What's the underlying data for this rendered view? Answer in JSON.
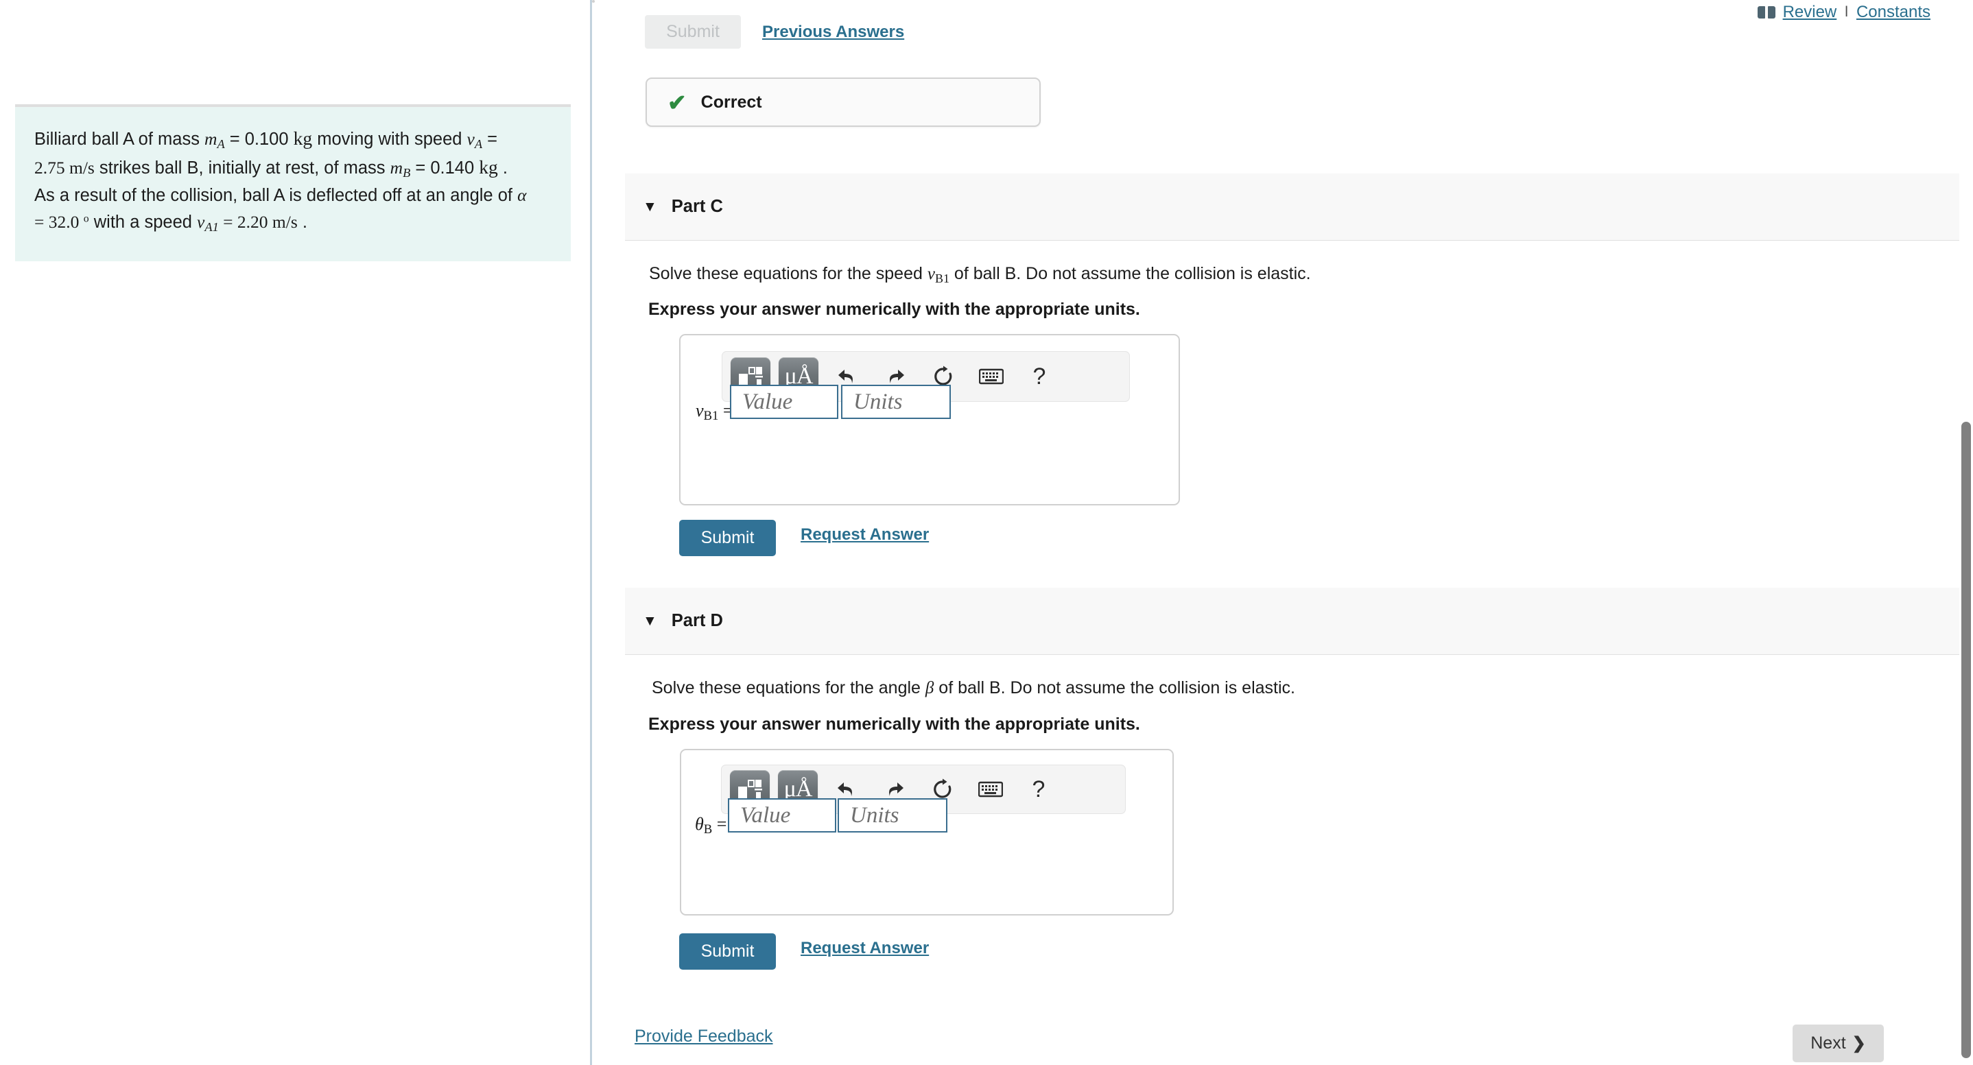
{
  "top_links": {
    "book_icon": "book-icon",
    "review": "Review",
    "separator": "l",
    "constants": "Constants"
  },
  "previous_section": {
    "submit_disabled_label": "Submit",
    "previous_answers_label": "Previous Answers",
    "feedback_icon": "check-icon",
    "feedback_label": "Correct"
  },
  "problem": {
    "line1_a": "Billiard ball A of mass ",
    "m_A": "m",
    "m_A_sub": "A",
    "eq1": " = 0.100 ",
    "kg1": "kg",
    "line1_b": " moving with speed ",
    "v_A": "v",
    "v_A_sub": "A",
    "eq2": " =",
    "line2_a": "2.75 ",
    "ms1": "m/s",
    "line2_b": " strikes ball B, initially at rest, of mass ",
    "m_B": "m",
    "m_B_sub": "B",
    "eq3": " = 0.140 ",
    "kg2": "kg",
    "line2_c": " .",
    "line3": "As a result of the collision, ball A is deflected off at an angle of ",
    "alpha": "α",
    "line4_a": "= 32.0 ",
    "degree": "o",
    "line4_b": " with a speed ",
    "v_A1": "v",
    "v_A1_sub": "A1",
    "eq4": " = 2.20 ",
    "ms2": "m/s",
    "line4_c": " ."
  },
  "parts": [
    {
      "caret": "▼",
      "title": "Part C",
      "prompt_pre": "Solve these equations for the speed ",
      "prompt_var": "v",
      "prompt_var_sub": "B1",
      "prompt_post": " of ball B. Do not assume the collision is elastic.",
      "express": "Express your answer numerically with the appropriate units.",
      "eq_label_var": "v",
      "eq_label_sub": "B1",
      "eq_label_equals": "=",
      "value_placeholder": "Value",
      "units_placeholder": "Units",
      "value_text": "",
      "units_text": "",
      "submit_label": "Submit",
      "request_answer_label": "Request Answer",
      "toolbar": [
        {
          "icon": "template-matrix-icon",
          "label": ""
        },
        {
          "icon": "micro-angstrom-units-icon",
          "label": "μÅ"
        },
        {
          "icon": "undo-icon",
          "label": ""
        },
        {
          "icon": "redo-icon",
          "label": ""
        },
        {
          "icon": "reset-icon",
          "label": ""
        },
        {
          "icon": "keyboard-icon",
          "label": ""
        },
        {
          "icon": "help-icon",
          "label": "?"
        }
      ]
    },
    {
      "caret": "▼",
      "title": "Part D",
      "prompt_pre": "Solve these equations for the angle ",
      "prompt_var": "β",
      "prompt_var_sub": "",
      "prompt_post": " of ball B. Do not assume the collision is elastic.",
      "express": "Express your answer numerically with the appropriate units.",
      "eq_label_var": "θ",
      "eq_label_sub": "B",
      "eq_label_equals": "=",
      "value_placeholder": "Value",
      "units_placeholder": "Units",
      "value_text": "",
      "units_text": "",
      "submit_label": "Submit",
      "request_answer_label": "Request Answer",
      "toolbar": [
        {
          "icon": "template-matrix-icon",
          "label": ""
        },
        {
          "icon": "micro-angstrom-units-icon",
          "label": "μÅ"
        },
        {
          "icon": "undo-icon",
          "label": ""
        },
        {
          "icon": "redo-icon",
          "label": ""
        },
        {
          "icon": "reset-icon",
          "label": ""
        },
        {
          "icon": "keyboard-icon",
          "label": ""
        },
        {
          "icon": "help-icon",
          "label": "?"
        }
      ]
    }
  ],
  "footer": {
    "provide_feedback": "Provide Feedback",
    "next_label": "Next",
    "next_chevron": "❯"
  },
  "colors": {
    "link": "#2a6f8e",
    "submit_bg": "#317296",
    "correct_green": "#2e8b40",
    "problem_bg": "#e8f5f3",
    "part_header_bg": "#f8f8f8",
    "field_border": "#3a6e8f"
  }
}
